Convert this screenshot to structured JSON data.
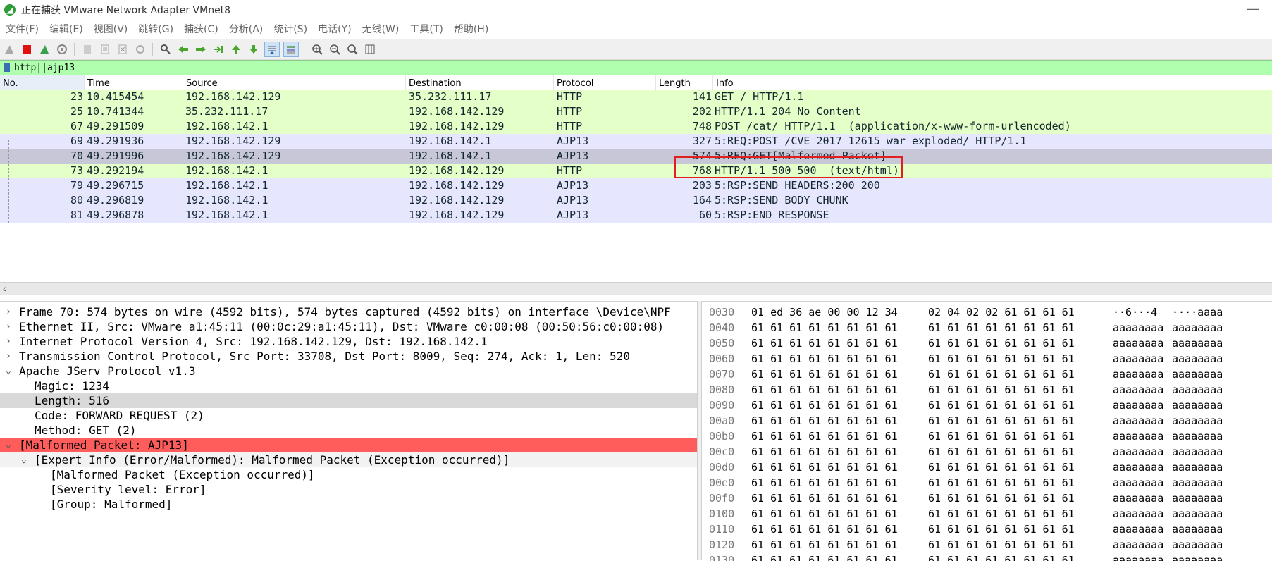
{
  "window": {
    "title": "正在捕获 VMware Network Adapter VMnet8",
    "minimize_glyph": "—",
    "colors": {
      "http_row": "#e4ffc7",
      "ajp_row": "#e7e6ff",
      "selected_row": "#c8c7d7",
      "malformed": "#ff5c5c",
      "filter_bg": "#afffaf"
    }
  },
  "menu": [
    "文件(F)",
    "编辑(E)",
    "视图(V)",
    "跳转(G)",
    "捕获(C)",
    "分析(A)",
    "统计(S)",
    "电话(Y)",
    "无线(W)",
    "工具(T)",
    "帮助(H)"
  ],
  "toolbar_icons": [
    "shark-fin-start-icon",
    "stop-capture-icon",
    "restart-capture-icon",
    "capture-options-icon",
    "open-file-icon",
    "save-file-icon",
    "close-file-icon",
    "reload-icon",
    "find-packet-icon",
    "go-back-icon",
    "go-forward-icon",
    "go-to-packet-icon",
    "first-packet-icon",
    "last-packet-icon",
    "autoscroll-icon",
    "colorize-icon",
    "zoom-in-icon",
    "zoom-out-icon",
    "normal-size-icon",
    "resize-columns-icon"
  ],
  "filter": {
    "value": "http||ajp13"
  },
  "columns": [
    "No.",
    "Time",
    "Source",
    "Destination",
    "Protocol",
    "Length",
    "Info"
  ],
  "packets": [
    {
      "no": "23",
      "time": "10.415454",
      "src": "192.168.142.129",
      "dst": "35.232.111.17",
      "proto": "HTTP",
      "len": "141",
      "info": "GET / HTTP/1.1",
      "kind": "http"
    },
    {
      "no": "25",
      "time": "10.741344",
      "src": "35.232.111.17",
      "dst": "192.168.142.129",
      "proto": "HTTP",
      "len": "202",
      "info": "HTTP/1.1 204 No Content",
      "kind": "http"
    },
    {
      "no": "67",
      "time": "49.291509",
      "src": "192.168.142.1",
      "dst": "192.168.142.129",
      "proto": "HTTP",
      "len": "748",
      "info": "POST /cat/ HTTP/1.1  (application/x-www-form-urlencoded)",
      "kind": "http"
    },
    {
      "no": "69",
      "time": "49.291936",
      "src": "192.168.142.129",
      "dst": "192.168.142.1",
      "proto": "AJP13",
      "len": "327",
      "info": "5:REQ:POST /CVE_2017_12615_war_exploded/ HTTP/1.1",
      "kind": "ajp"
    },
    {
      "no": "70",
      "time": "49.291996",
      "src": "192.168.142.129",
      "dst": "192.168.142.1",
      "proto": "AJP13",
      "len": "574",
      "info": "5:REQ:GET[Malformed Packet]",
      "kind": "selected"
    },
    {
      "no": "73",
      "time": "49.292194",
      "src": "192.168.142.1",
      "dst": "192.168.142.129",
      "proto": "HTTP",
      "len": "768",
      "info": "HTTP/1.1 500 500  (text/html)",
      "kind": "http"
    },
    {
      "no": "79",
      "time": "49.296715",
      "src": "192.168.142.1",
      "dst": "192.168.142.129",
      "proto": "AJP13",
      "len": "203",
      "info": "5:RSP:SEND HEADERS:200 200",
      "kind": "ajp"
    },
    {
      "no": "80",
      "time": "49.296819",
      "src": "192.168.142.1",
      "dst": "192.168.142.129",
      "proto": "AJP13",
      "len": "164",
      "info": "5:RSP:SEND BODY CHUNK",
      "kind": "ajp"
    },
    {
      "no": "81",
      "time": "49.296878",
      "src": "192.168.142.1",
      "dst": "192.168.142.129",
      "proto": "AJP13",
      "len": "60",
      "info": "5:RSP:END RESPONSE",
      "kind": "ajp"
    }
  ],
  "details": [
    {
      "indent": 0,
      "chevron": "›",
      "text": "Frame 70: 574 bytes on wire (4592 bits), 574 bytes captured (4592 bits) on interface \\Device\\NPF",
      "style": "normal"
    },
    {
      "indent": 0,
      "chevron": "›",
      "text": "Ethernet II, Src: VMware_a1:45:11 (00:0c:29:a1:45:11), Dst: VMware_c0:00:08 (00:50:56:c0:00:08)",
      "style": "normal"
    },
    {
      "indent": 0,
      "chevron": "›",
      "text": "Internet Protocol Version 4, Src: 192.168.142.129, Dst: 192.168.142.1",
      "style": "normal"
    },
    {
      "indent": 0,
      "chevron": "›",
      "text": "Transmission Control Protocol, Src Port: 33708, Dst Port: 8009, Seq: 274, Ack: 1, Len: 520",
      "style": "normal"
    },
    {
      "indent": 0,
      "chevron": "⌄",
      "text": "Apache JServ Protocol v1.3",
      "style": "normal"
    },
    {
      "indent": 1,
      "chevron": "",
      "text": "Magic: 1234",
      "style": "normal"
    },
    {
      "indent": 1,
      "chevron": "",
      "text": "Length: 516",
      "style": "highlight"
    },
    {
      "indent": 1,
      "chevron": "",
      "text": "Code: FORWARD REQUEST (2)",
      "style": "normal"
    },
    {
      "indent": 1,
      "chevron": "",
      "text": "Method: GET (2)",
      "style": "normal"
    },
    {
      "indent": 0,
      "chevron": "⌄",
      "text": "[Malformed Packet: AJP13]",
      "style": "error"
    },
    {
      "indent": 1,
      "chevron": "⌄",
      "text": "[Expert Info (Error/Malformed): Malformed Packet (Exception occurred)]",
      "style": "expert"
    },
    {
      "indent": 2,
      "chevron": "",
      "text": "[Malformed Packet (Exception occurred)]",
      "style": "normal"
    },
    {
      "indent": 2,
      "chevron": "",
      "text": "[Severity level: Error]",
      "style": "normal"
    },
    {
      "indent": 2,
      "chevron": "",
      "text": "[Group: Malformed]",
      "style": "normal"
    }
  ],
  "bytes": [
    {
      "offset": "0030",
      "hex1": "01 ed 36 ae 00 00 12 34",
      "hex2": "02 04 02 02 61 61 61 61",
      "ascii1": "··6···4",
      "ascii2": "····aaaa"
    },
    {
      "offset": "0040",
      "hex1": "61 61 61 61 61 61 61 61",
      "hex2": "61 61 61 61 61 61 61 61",
      "ascii1": "aaaaaaaa",
      "ascii2": "aaaaaaaa"
    },
    {
      "offset": "0050",
      "hex1": "61 61 61 61 61 61 61 61",
      "hex2": "61 61 61 61 61 61 61 61",
      "ascii1": "aaaaaaaa",
      "ascii2": "aaaaaaaa"
    },
    {
      "offset": "0060",
      "hex1": "61 61 61 61 61 61 61 61",
      "hex2": "61 61 61 61 61 61 61 61",
      "ascii1": "aaaaaaaa",
      "ascii2": "aaaaaaaa"
    },
    {
      "offset": "0070",
      "hex1": "61 61 61 61 61 61 61 61",
      "hex2": "61 61 61 61 61 61 61 61",
      "ascii1": "aaaaaaaa",
      "ascii2": "aaaaaaaa"
    },
    {
      "offset": "0080",
      "hex1": "61 61 61 61 61 61 61 61",
      "hex2": "61 61 61 61 61 61 61 61",
      "ascii1": "aaaaaaaa",
      "ascii2": "aaaaaaaa"
    },
    {
      "offset": "0090",
      "hex1": "61 61 61 61 61 61 61 61",
      "hex2": "61 61 61 61 61 61 61 61",
      "ascii1": "aaaaaaaa",
      "ascii2": "aaaaaaaa"
    },
    {
      "offset": "00a0",
      "hex1": "61 61 61 61 61 61 61 61",
      "hex2": "61 61 61 61 61 61 61 61",
      "ascii1": "aaaaaaaa",
      "ascii2": "aaaaaaaa"
    },
    {
      "offset": "00b0",
      "hex1": "61 61 61 61 61 61 61 61",
      "hex2": "61 61 61 61 61 61 61 61",
      "ascii1": "aaaaaaaa",
      "ascii2": "aaaaaaaa"
    },
    {
      "offset": "00c0",
      "hex1": "61 61 61 61 61 61 61 61",
      "hex2": "61 61 61 61 61 61 61 61",
      "ascii1": "aaaaaaaa",
      "ascii2": "aaaaaaaa"
    },
    {
      "offset": "00d0",
      "hex1": "61 61 61 61 61 61 61 61",
      "hex2": "61 61 61 61 61 61 61 61",
      "ascii1": "aaaaaaaa",
      "ascii2": "aaaaaaaa"
    },
    {
      "offset": "00e0",
      "hex1": "61 61 61 61 61 61 61 61",
      "hex2": "61 61 61 61 61 61 61 61",
      "ascii1": "aaaaaaaa",
      "ascii2": "aaaaaaaa"
    },
    {
      "offset": "00f0",
      "hex1": "61 61 61 61 61 61 61 61",
      "hex2": "61 61 61 61 61 61 61 61",
      "ascii1": "aaaaaaaa",
      "ascii2": "aaaaaaaa"
    },
    {
      "offset": "0100",
      "hex1": "61 61 61 61 61 61 61 61",
      "hex2": "61 61 61 61 61 61 61 61",
      "ascii1": "aaaaaaaa",
      "ascii2": "aaaaaaaa"
    },
    {
      "offset": "0110",
      "hex1": "61 61 61 61 61 61 61 61",
      "hex2": "61 61 61 61 61 61 61 61",
      "ascii1": "aaaaaaaa",
      "ascii2": "aaaaaaaa"
    },
    {
      "offset": "0120",
      "hex1": "61 61 61 61 61 61 61 61",
      "hex2": "61 61 61 61 61 61 61 61",
      "ascii1": "aaaaaaaa",
      "ascii2": "aaaaaaaa"
    },
    {
      "offset": "0130",
      "hex1": "61 61 61 61 61 61 61 61",
      "hex2": "61 61 61 61 61 61 61 61",
      "ascii1": "aaaaaaaa",
      "ascii2": "aaaaaaaa"
    }
  ]
}
